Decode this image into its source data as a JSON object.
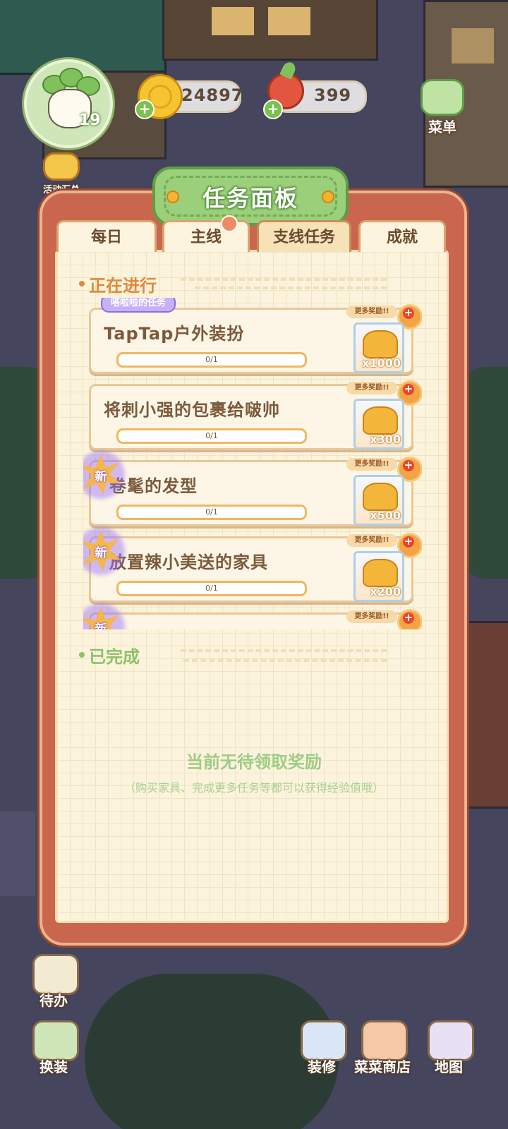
{
  "hud": {
    "level": "19",
    "coins": "24897",
    "radish": "399",
    "activity_label": "活动汇总",
    "menu_label": "菜单"
  },
  "panel": {
    "title": "任务面板",
    "tabs": [
      {
        "label": "每日",
        "active": false
      },
      {
        "label": "主线",
        "active": false,
        "badge": true
      },
      {
        "label": "支线任务",
        "active": true
      },
      {
        "label": "成就",
        "active": false
      }
    ],
    "in_progress_label": "正在进行",
    "completed_label": "已完成",
    "tasks": [
      {
        "owner": "嗒啦啦的任务",
        "name": "TapTap户外装扮",
        "progress": "0/1",
        "reward": "x1000",
        "more": "更多奖励!!",
        "new": false
      },
      {
        "name": "将刺小强的包裹给啵帅",
        "progress": "0/1",
        "reward": "x300",
        "more": "更多奖励!!",
        "new": false
      },
      {
        "name": "卷髦的发型",
        "progress": "0/1",
        "reward": "x500",
        "more": "更多奖励!!",
        "new": true,
        "new_label": "新"
      },
      {
        "name": "放置辣小美送的家具",
        "progress": "0/1",
        "reward": "x200",
        "more": "更多奖励!!",
        "new": true,
        "new_label": "新"
      },
      {
        "name": "",
        "progress": "",
        "reward": "",
        "more": "更多奖励!!",
        "new": true,
        "new_label": "新"
      }
    ],
    "empty_title": "当前无待领取奖励",
    "empty_hint": "（购买家具、完成更多任务等都可以获得经验值哦）"
  },
  "bottom_bar": {
    "todo": "待办",
    "dress": "换装",
    "decorate": "装修",
    "shop": "菜菜商店",
    "map": "地图"
  },
  "colors": {
    "panel_frame": "#c9664d",
    "paper": "#fbf3dc",
    "title_green": "#9bcf7a",
    "accent_orange": "#e0893c",
    "done_green": "#8cc26a"
  }
}
